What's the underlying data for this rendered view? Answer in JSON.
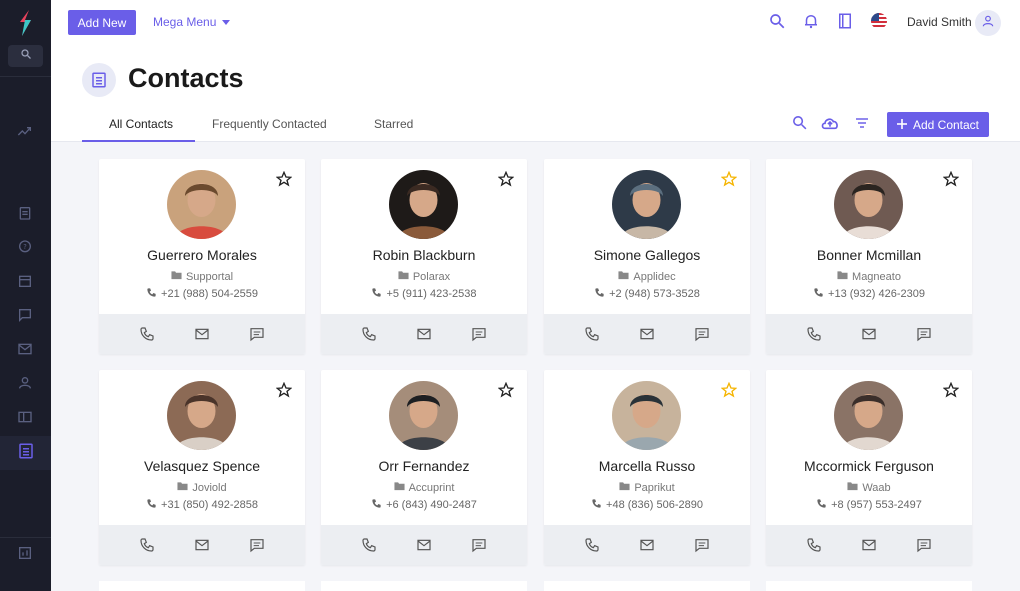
{
  "topbar": {
    "add_new_label": "Add New",
    "mega_menu_label": "Mega Menu",
    "user_name": "David Smith"
  },
  "page": {
    "title": "Contacts"
  },
  "tabs": [
    {
      "label": "All Contacts",
      "active": true
    },
    {
      "label": "Frequently Contacted",
      "active": false
    },
    {
      "label": "Starred",
      "active": false
    }
  ],
  "add_contact_label": "Add Contact",
  "colors": {
    "accent": "#6a5ee8",
    "sidebar": "#1b1d2a",
    "star_active": "#f5b400"
  },
  "contacts": [
    {
      "name": "Guerrero Morales",
      "company": "Supportal",
      "phone": "+21 (988) 504-2559",
      "starred": false
    },
    {
      "name": "Robin Blackburn",
      "company": "Polarax",
      "phone": "+5 (911) 423-2538",
      "starred": false
    },
    {
      "name": "Simone Gallegos",
      "company": "Applidec",
      "phone": "+2 (948) 573-3528",
      "starred": true
    },
    {
      "name": "Bonner Mcmillan",
      "company": "Magneato",
      "phone": "+13 (932) 426-2309",
      "starred": false
    },
    {
      "name": "Velasquez Spence",
      "company": "Joviold",
      "phone": "+31 (850) 492-2858",
      "starred": false
    },
    {
      "name": "Orr Fernandez",
      "company": "Accuprint",
      "phone": "+6 (843) 490-2487",
      "starred": false
    },
    {
      "name": "Marcella Russo",
      "company": "Paprikut",
      "phone": "+48 (836) 506-2890",
      "starred": true
    },
    {
      "name": "Mccormick Ferguson",
      "company": "Waab",
      "phone": "+8 (957) 553-2497",
      "starred": false
    }
  ]
}
